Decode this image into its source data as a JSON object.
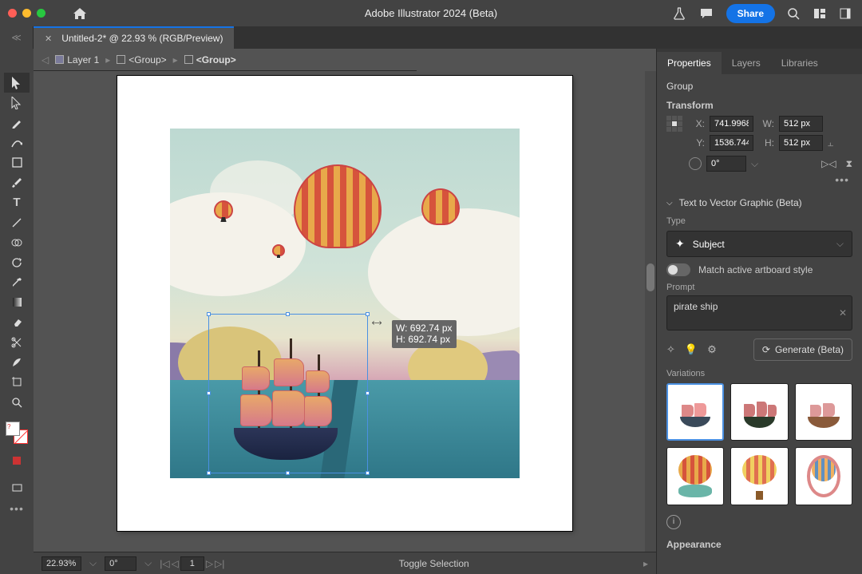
{
  "app_title": "Adobe Illustrator 2024 (Beta)",
  "share_label": "Share",
  "doc_tab": "Untitled-2* @ 22.93 % (RGB/Preview)",
  "breadcrumb": {
    "layer": "Layer 1",
    "seg1": "<Group>",
    "seg2": "<Group>"
  },
  "measure": {
    "w": "W: 692.74 px",
    "h": "H: 692.74 px"
  },
  "bottom": {
    "zoom": "22.93%",
    "rotate": "0°",
    "page": "1",
    "status": "Toggle Selection"
  },
  "panel": {
    "tabs": {
      "properties": "Properties",
      "layers": "Layers",
      "libraries": "Libraries"
    },
    "selection": "Group",
    "transform": {
      "label": "Transform",
      "x_lbl": "X:",
      "x": "741.9968",
      "w_lbl": "W:",
      "w": "512 px",
      "y_lbl": "Y:",
      "y": "1536.744",
      "h_lbl": "H:",
      "h": "512 px",
      "rotate": "0°"
    },
    "t2v": "Text to Vector Graphic (Beta)",
    "type_lbl": "Type",
    "type_val": "Subject",
    "match_style": "Match active artboard style",
    "prompt_lbl": "Prompt",
    "prompt_val": "pirate ship",
    "generate": "Generate (Beta)",
    "variations_lbl": "Variations",
    "appearance_lbl": "Appearance"
  }
}
